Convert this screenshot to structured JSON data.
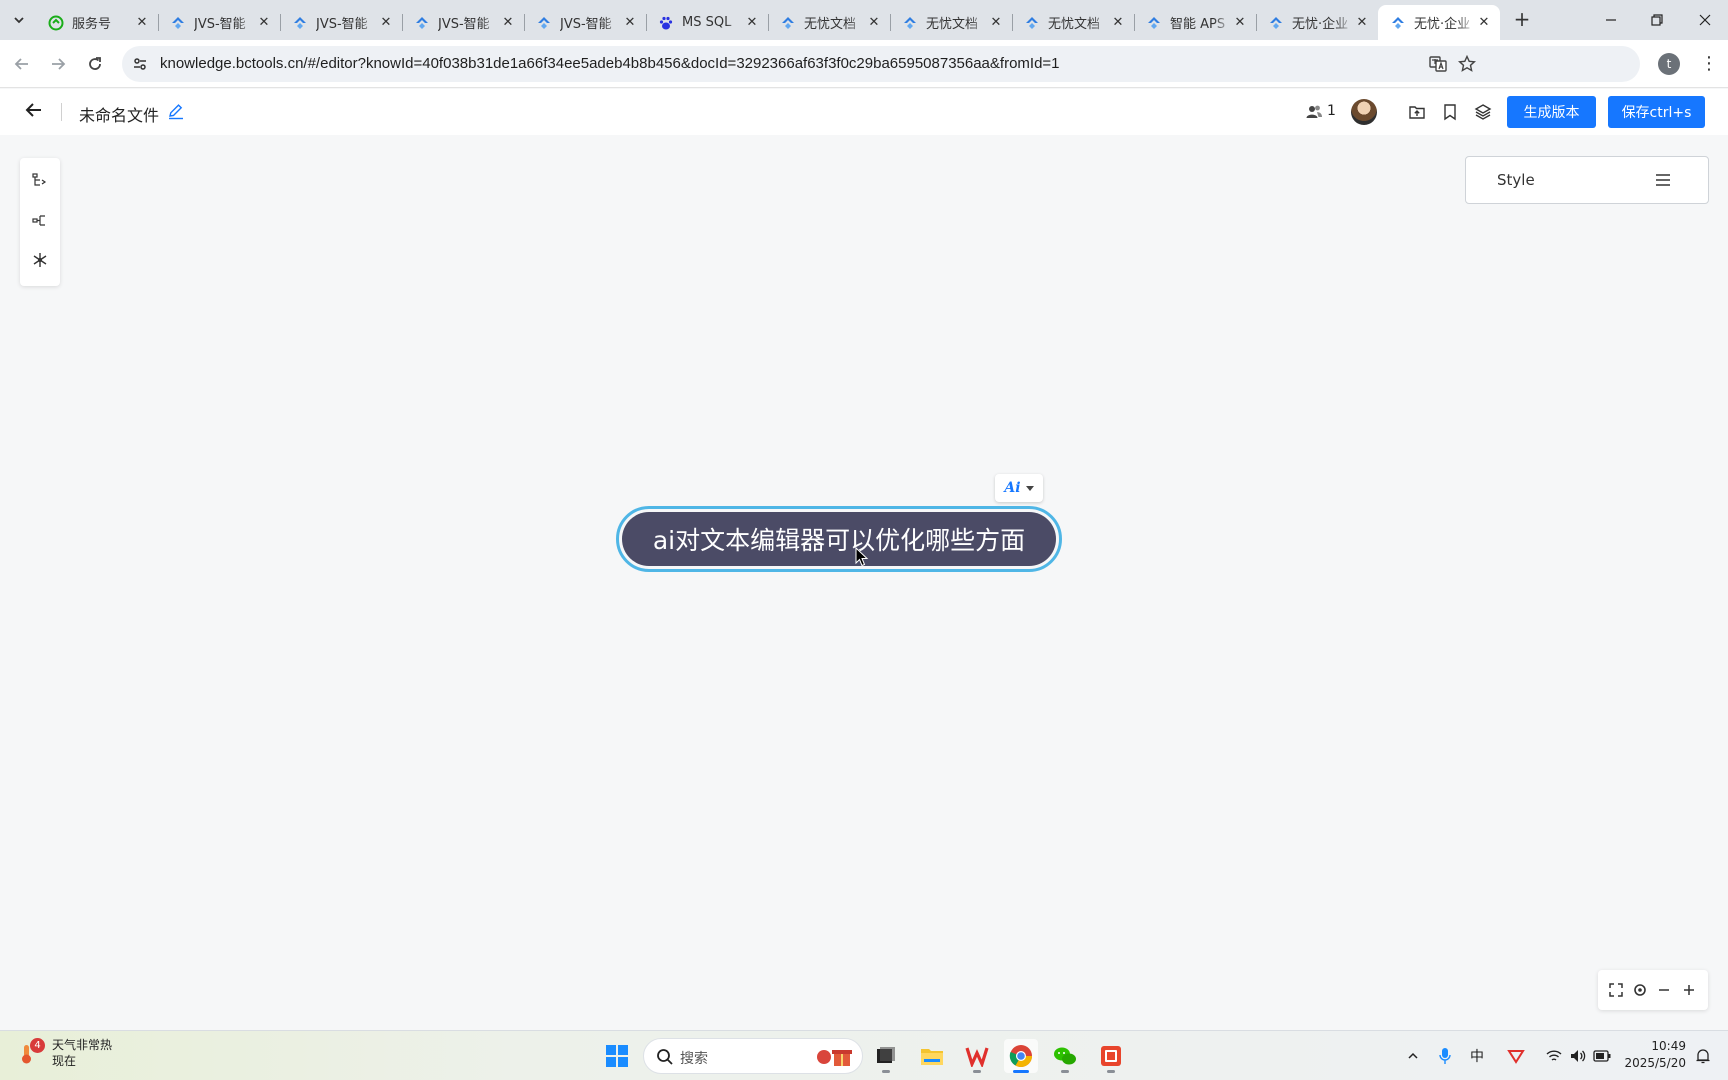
{
  "browser": {
    "tabs": [
      {
        "title": "服务号",
        "icon": "wechat-green-icon",
        "active": false
      },
      {
        "title": "JVS-智能",
        "icon": "jvs-icon",
        "active": false
      },
      {
        "title": "JVS-智能",
        "icon": "jvs-icon",
        "active": false
      },
      {
        "title": "JVS-智能",
        "icon": "jvs-icon",
        "active": false
      },
      {
        "title": "JVS-智能",
        "icon": "jvs-icon",
        "active": false
      },
      {
        "title": "MS SQL",
        "icon": "baidu-paw-icon",
        "active": false
      },
      {
        "title": "无忧文档",
        "icon": "jvs-icon",
        "active": false
      },
      {
        "title": "无忧文档",
        "icon": "jvs-icon",
        "active": false
      },
      {
        "title": "无忧文档",
        "icon": "jvs-icon",
        "active": false
      },
      {
        "title": "智能 APS",
        "icon": "jvs-icon",
        "active": false
      },
      {
        "title": "无忧·企业",
        "icon": "jvs-icon",
        "active": false
      },
      {
        "title": "无忧·企业",
        "icon": "jvs-icon",
        "active": true
      }
    ],
    "url": "knowledge.bctools.cn/#/editor?knowId=40f038b31de1a66f34ee5adeb4b8b456&docId=3292366af63f3f0c29ba6595087356aa&fromId=1",
    "profile_initial": "t"
  },
  "header": {
    "title": "未命名文件",
    "collaborators_count": "1",
    "generate_version_label": "生成版本",
    "save_label": "保存ctrl+s"
  },
  "canvas": {
    "style_panel_label": "Style",
    "ai_chip_label": "Ai",
    "root_node_text": "ai对文本编辑器可以优化哪些方面"
  },
  "taskbar": {
    "weather_badge": "4",
    "weather_title": "天气非常热",
    "weather_sub": "现在",
    "search_label": "搜索",
    "ime_label": "中",
    "time": "10:49",
    "date": "2025/5/20"
  },
  "colors": {
    "accent": "#1677ff",
    "node_fill": "#4b4b66",
    "node_border": "#4fb6e6"
  }
}
